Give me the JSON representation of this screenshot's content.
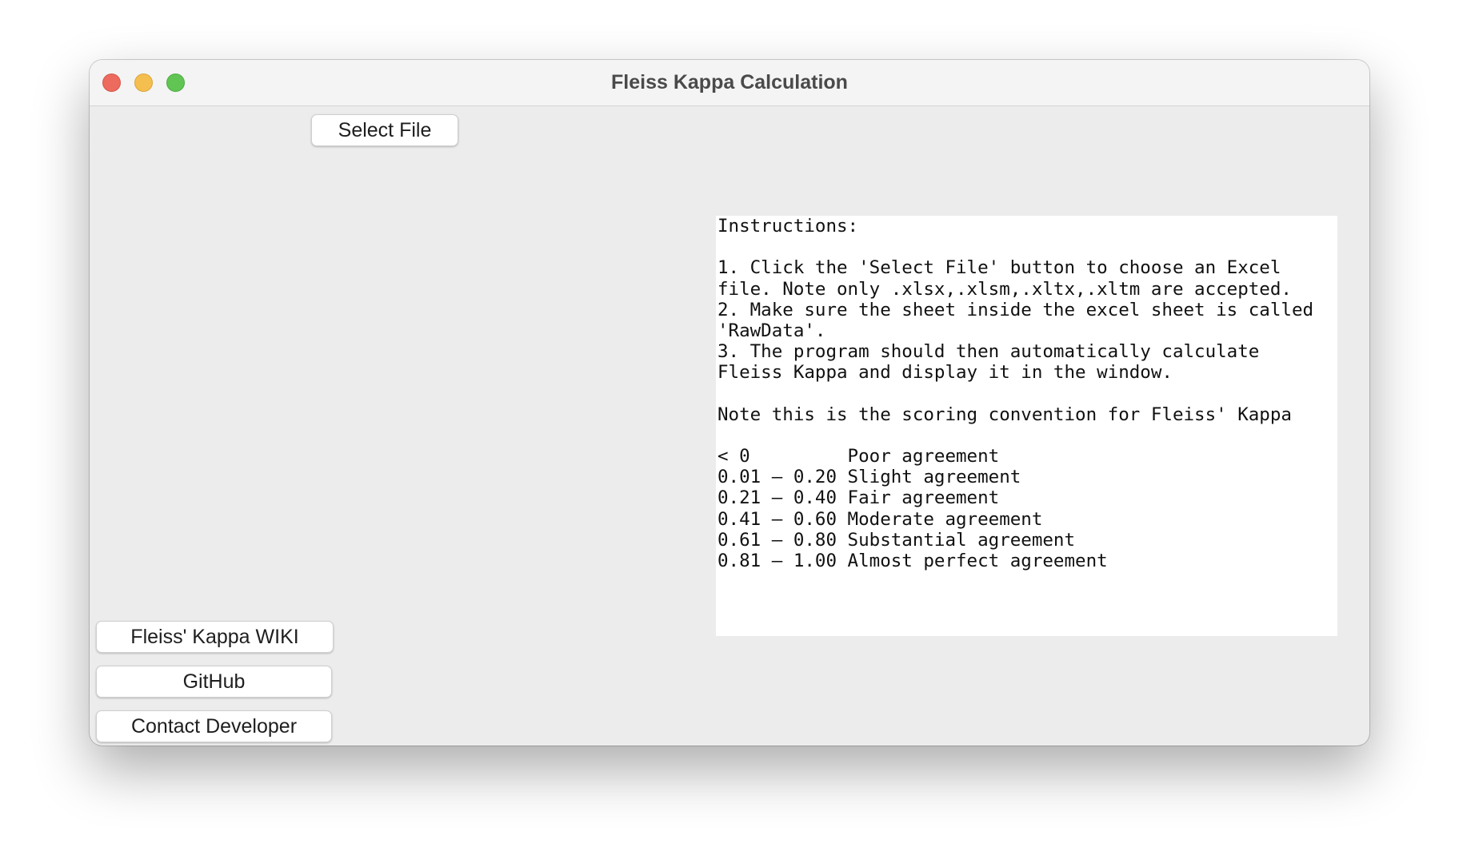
{
  "window": {
    "title": "Fleiss Kappa Calculation"
  },
  "buttons": {
    "select_file": "Select File",
    "wiki": "Fleiss' Kappa WIKI",
    "github": "GitHub",
    "contact": "Contact Developer"
  },
  "instructions": {
    "lines": [
      "Instructions:",
      "",
      "1. Click the 'Select File' button to choose an Excel",
      "file. Note only .xlsx,.xlsm,.xltx,.xltm are accepted.",
      "2. Make sure the sheet inside the excel sheet is called",
      "'RawData'.",
      "3. The program should then automatically calculate",
      "Fleiss Kappa and display it in the window.",
      "",
      "Note this is the scoring convention for Fleiss' Kappa",
      "",
      "< 0         Poor agreement",
      "0.01 – 0.20 Slight agreement",
      "0.21 – 0.40 Fair agreement",
      "0.41 – 0.60 Moderate agreement",
      "0.61 – 0.80 Substantial agreement",
      "0.81 – 1.00 Almost perfect agreement"
    ]
  },
  "colors": {
    "close": "#ed6a5e",
    "minimize": "#f5bf4f",
    "maximize": "#61c554",
    "window_bg": "#ececec",
    "text_area_bg": "#ffffff"
  }
}
